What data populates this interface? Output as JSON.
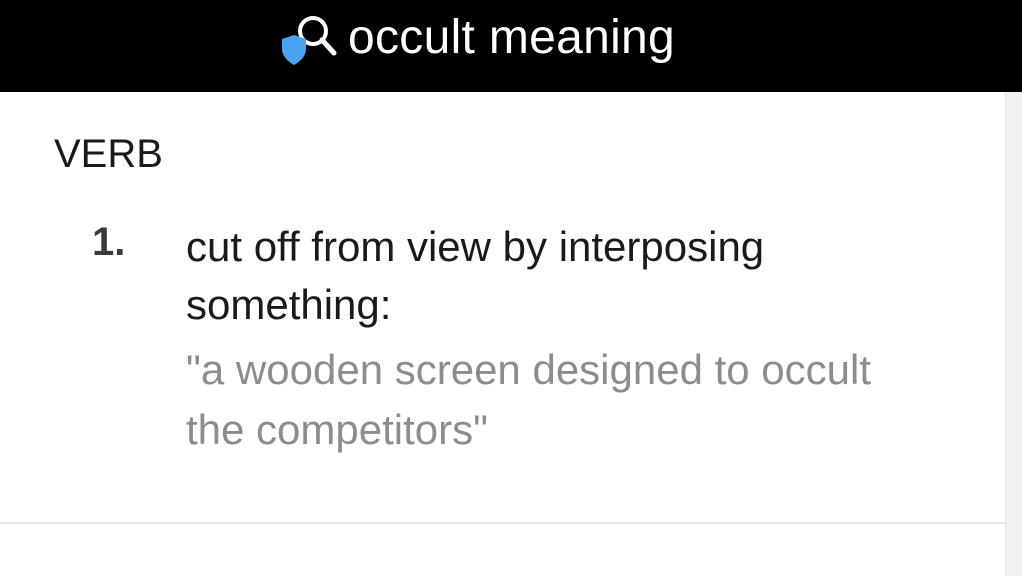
{
  "search": {
    "query": "occult meaning",
    "icon": "shield-search-icon",
    "shield_color": "#4aa3f0"
  },
  "entry": {
    "part_of_speech": "VERB",
    "definitions": [
      {
        "number": "1.",
        "text": "cut off from view by interposing something:",
        "example": "\"a wooden screen designed to occult the competitors\""
      }
    ]
  },
  "colors": {
    "topbar": "#000000",
    "text_primary": "#1a1a1a",
    "text_example": "#8c8c8c"
  }
}
